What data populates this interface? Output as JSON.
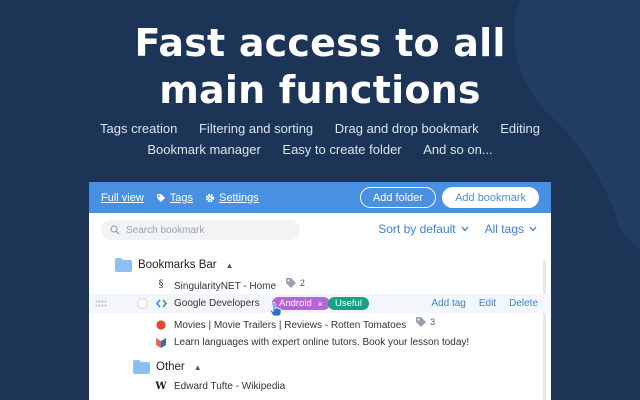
{
  "headline": {
    "line1": "Fast access to all",
    "line2": "main functions"
  },
  "features": {
    "row1": [
      "Tags creation",
      "Filtering and sorting",
      "Drag and drop bookmark",
      "Editing"
    ],
    "row2": [
      "Bookmark manager",
      "Easy to create folder",
      "And so on..."
    ]
  },
  "toolbar": {
    "full_view": "Full view",
    "tags": "Tags",
    "settings": "Settings",
    "add_folder": "Add folder",
    "add_bookmark": "Add bookmark"
  },
  "search": {
    "placeholder": "Search bookmark"
  },
  "sort": {
    "sort_label": "Sort by default",
    "filter_label": "All tags"
  },
  "folders": [
    {
      "name": "Bookmarks Bar",
      "bookmarks": [
        {
          "title": "SingularityNET - Home",
          "tag_count": "2",
          "favicon": "singularity-icon"
        },
        {
          "title": "Google Developers",
          "tags": [
            "Android",
            "Useful"
          ],
          "favicon": "google-developers-icon",
          "actions": [
            "Add tag",
            "Edit",
            "Delete"
          ]
        },
        {
          "title": "Movies | Movie Trailers | Reviews - Rotten Tomatoes",
          "tag_count": "3",
          "favicon": "tomato-icon"
        },
        {
          "title": "Learn languages with expert online tutors. Book your lesson today!",
          "favicon": "italki-icon"
        }
      ]
    },
    {
      "name": "Other",
      "bookmarks": [
        {
          "title": "Edward Tufte - Wikipedia",
          "favicon": "wikipedia-icon"
        }
      ]
    }
  ],
  "colors": {
    "background": "#1c3557",
    "accent": "#4a90e2",
    "tag_android": "#b565d9",
    "tag_useful": "#1aa085"
  }
}
